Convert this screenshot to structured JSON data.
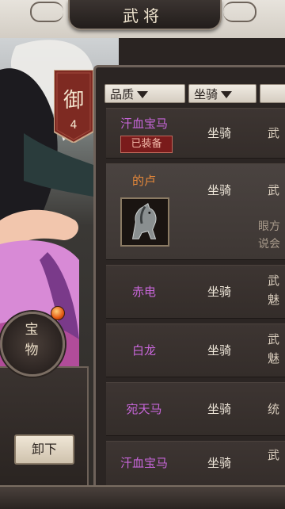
{
  "header": {
    "title": "武将"
  },
  "rank": {
    "char": "御",
    "level": "4"
  },
  "treasure": {
    "label_top": "宝",
    "label_bottom": "物"
  },
  "actions": {
    "unequip_label": "卸下"
  },
  "filters": [
    {
      "label": "品质"
    },
    {
      "label": "坐骑"
    }
  ],
  "colors": {
    "rare_name": "#c766d9",
    "epic_name": "#e8893a",
    "type_text": "#efe7da"
  },
  "items": [
    {
      "name": "汗血宝马",
      "type": "坐骑",
      "stat1": "武",
      "badge": "已装备",
      "rarity": "rare"
    },
    {
      "name": "的卢",
      "type": "坐骑",
      "stat1": "武",
      "desc1": "眼方",
      "desc2": "说会",
      "rarity": "epic"
    },
    {
      "name": "赤电",
      "type": "坐骑",
      "stat1": "武",
      "stat2": "魅",
      "rarity": "rare"
    },
    {
      "name": "白龙",
      "type": "坐骑",
      "stat1": "武",
      "stat2": "魅",
      "rarity": "rare"
    },
    {
      "name": "宛天马",
      "type": "坐骑",
      "stat1": "统",
      "rarity": "rare"
    },
    {
      "name": "汗血宝马",
      "type": "坐骑",
      "stat1": "武",
      "rarity": "rare"
    }
  ]
}
